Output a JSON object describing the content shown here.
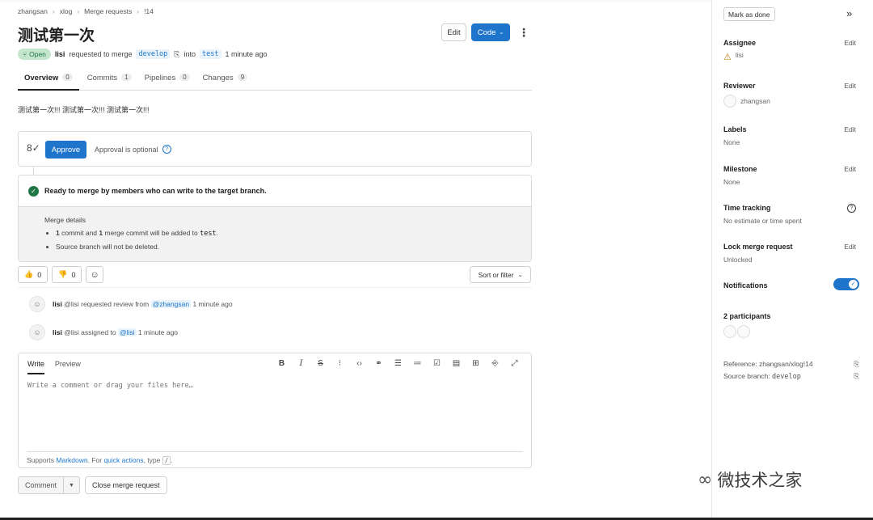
{
  "breadcrumb": [
    "zhangsan",
    "xlog",
    "Merge requests",
    "!14"
  ],
  "title": "测试第一次",
  "header": {
    "edit_label": "Edit",
    "code_label": "Code"
  },
  "meta": {
    "status": "Open",
    "author": "lisi",
    "text1": "requested to merge",
    "source_branch": "develop",
    "text2": "into",
    "target_branch": "test",
    "time": "1 minute ago"
  },
  "tabs": [
    {
      "label": "Overview",
      "count": "0"
    },
    {
      "label": "Commits",
      "count": "1"
    },
    {
      "label": "Pipelines",
      "count": "0"
    },
    {
      "label": "Changes",
      "count": "9"
    }
  ],
  "description": "测试第一次!!! 测试第一次!!! 测试第一次!!!",
  "approval": {
    "button": "Approve",
    "text": "Approval is optional"
  },
  "merge": {
    "ready_text": "Ready to merge by members who can write to the target branch.",
    "details_title": "Merge details",
    "detail1_pre": "1",
    "detail1_mid1": " commit and ",
    "detail1_num2": "1",
    "detail1_mid2": " merge commit will be added to ",
    "detail1_branch": "test",
    "detail1_end": ".",
    "detail2": "Source branch will not be deleted."
  },
  "reactions": {
    "thumbs_up": "0",
    "thumbs_down": "0",
    "sort_label": "Sort or filter"
  },
  "activity": [
    {
      "user": "lisi",
      "handle": "@lisi",
      "text": "requested review from",
      "mention": "@zhangsan",
      "time": "1 minute ago"
    },
    {
      "user": "lisi",
      "handle": "@lisi",
      "text": "assigned to",
      "mention": "@lisi",
      "time": "1 minute ago"
    }
  ],
  "editor": {
    "tab_write": "Write",
    "tab_preview": "Preview",
    "placeholder": "Write a comment or drag your files here…",
    "footer_pre": "Supports ",
    "footer_link1": "Markdown",
    "footer_mid": ". For ",
    "footer_link2": "quick actions",
    "footer_post": ", type",
    "footer_kbd": "/",
    "footer_end": "."
  },
  "actions": {
    "comment": "Comment",
    "close": "Close merge request"
  },
  "sidebar": {
    "mark_done": "Mark as done",
    "edit": "Edit",
    "assignee_title": "Assignee",
    "assignee": "lisi",
    "reviewer_title": "Reviewer",
    "reviewer": "zhangsan",
    "labels_title": "Labels",
    "labels_value": "None",
    "milestone_title": "Milestone",
    "milestone_value": "None",
    "time_title": "Time tracking",
    "time_value": "No estimate or time spent",
    "lock_title": "Lock merge request",
    "lock_value": "Unlocked",
    "notifications_title": "Notifications",
    "participants_title": "2 participants",
    "reference": "Reference: zhangsan/xlog!14",
    "source_branch_label": "Source branch: ",
    "source_branch": "develop"
  },
  "watermark": "微技术之家",
  "colors": {
    "primary": "#1f75cb",
    "open_badge_bg": "#c3e6cd",
    "success": "#217645"
  }
}
